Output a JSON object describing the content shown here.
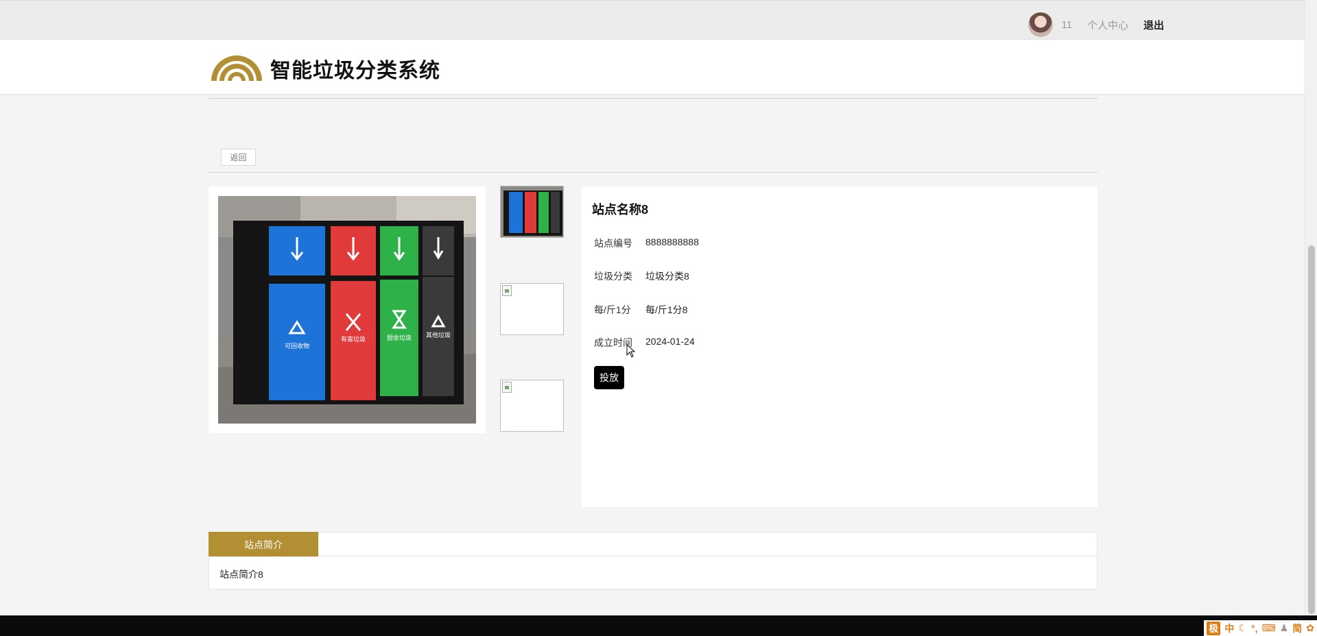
{
  "topbar": {
    "username": "11",
    "profile_label": "个人中心",
    "logout_label": "退出"
  },
  "header": {
    "title": "智能垃圾分类系统",
    "logo_color": "#b28f33"
  },
  "toolbar": {
    "back_label": "返回"
  },
  "station": {
    "name": "站点名称8",
    "fields": [
      {
        "label": "站点编号",
        "value": "8888888888"
      },
      {
        "label": "垃圾分类",
        "value": "垃圾分类8"
      },
      {
        "label": "每/斤1分",
        "value": "每/斤1分8"
      },
      {
        "label": "成立时间",
        "value": "2024-01-24"
      }
    ],
    "drop_label": "投放",
    "bin_labels": [
      "可回收物",
      "有害垃圾",
      "厨余垃圾",
      "其他垃圾"
    ],
    "bin_colors": [
      "#1e73d8",
      "#e03a3a",
      "#2fb14a",
      "#3a3a3a"
    ]
  },
  "tabs": {
    "active_label": "站点简介",
    "accent": "#b28f33",
    "content": "站点简介8"
  },
  "tray": {
    "ime_label": "极",
    "lang_label": "中",
    "mode_label": "简"
  }
}
